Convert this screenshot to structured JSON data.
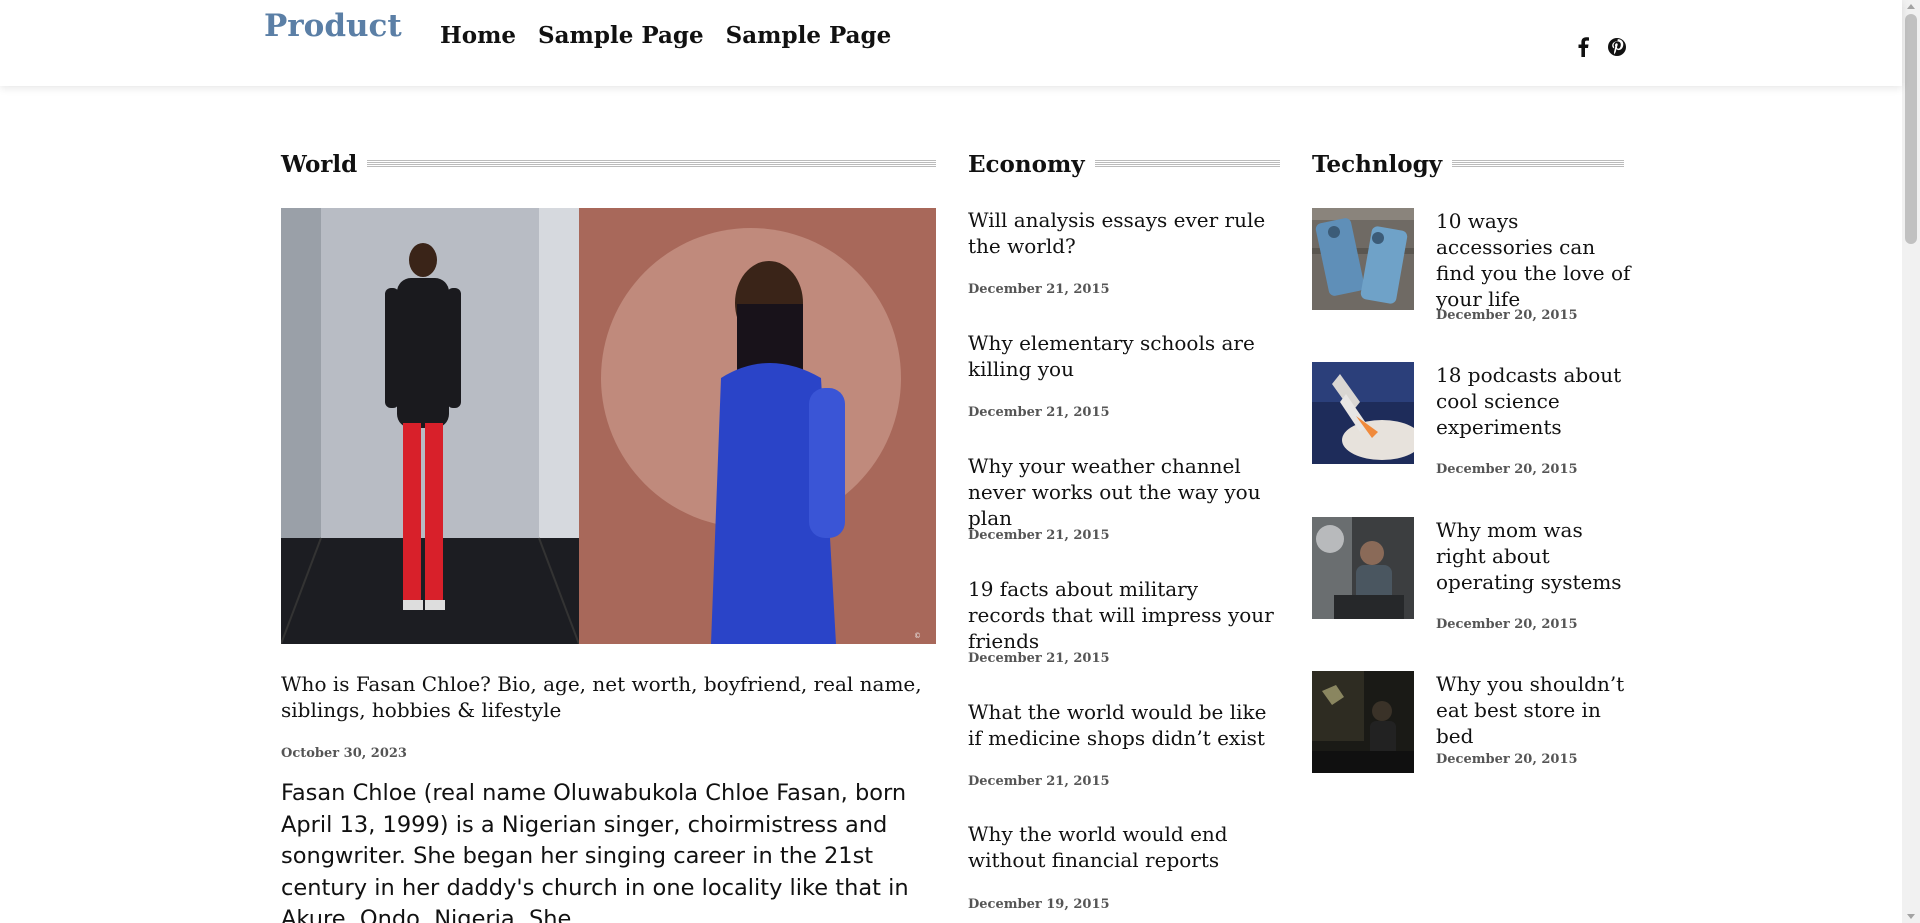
{
  "header": {
    "logo": "Product",
    "nav": [
      "Home",
      "Sample Page",
      "Sample Page"
    ],
    "social": [
      "facebook-icon",
      "pinterest-icon"
    ]
  },
  "sections": {
    "world": "World",
    "economy": "Economy",
    "technology": "Technlogy"
  },
  "world": {
    "title": "Who is Fasan Chloe? Bio, age, net worth, boyfriend, real name, siblings, hobbies & lifestyle",
    "date": "October 30, 2023",
    "excerpt": "Fasan Chloe (real name Oluwabukola Chloe Fasan, born April 13, 1999) is a Nigerian singer, choirmistress and songwriter. She began her singing career in the 21st century in her daddy's church in one locality like that in Akure, Ondo, Nigeria. She"
  },
  "economy": [
    {
      "title": "Will analysis essays ever rule the world?",
      "date": "December 21, 2015"
    },
    {
      "title": "Why elementary schools are killing you",
      "date": "December 21, 2015"
    },
    {
      "title": "Why your weather channel never works out the way you plan",
      "date": "December 21, 2015"
    },
    {
      "title": "19 facts about military records that will impress your friends",
      "date": "December 21, 2015"
    },
    {
      "title": "What the world would be like if medicine shops didn’t exist",
      "date": "December 21, 2015"
    },
    {
      "title": "Why the world would end without financial reports",
      "date": "December 19, 2015"
    }
  ],
  "technology": [
    {
      "title": "10 ways accessories can find you the love of your life",
      "date": "December 20, 2015"
    },
    {
      "title": "18 podcasts about cool science experiments",
      "date": "December 20, 2015"
    },
    {
      "title": "Why mom was right about operating systems",
      "date": "December 20, 2015"
    },
    {
      "title": "Why you shouldn’t eat best store in bed",
      "date": "December 20, 2015"
    }
  ]
}
